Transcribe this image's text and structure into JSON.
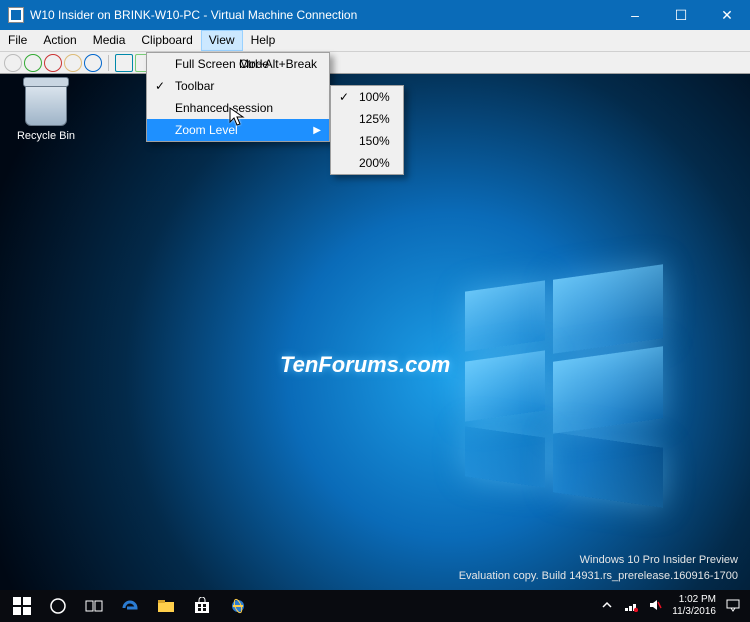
{
  "window": {
    "title": "W10 Insider on BRINK-W10-PC - Virtual Machine Connection",
    "minimize": "–",
    "maximize": "☐",
    "close": "✕"
  },
  "menubar": {
    "items": [
      "File",
      "Action",
      "Media",
      "Clipboard",
      "View",
      "Help"
    ],
    "open_index": 4
  },
  "view_menu": {
    "items": [
      {
        "label": "Full Screen Mode",
        "shortcut": "Ctrl+Alt+Break",
        "checked": false
      },
      {
        "label": "Toolbar",
        "checked": true
      },
      {
        "label": "Enhanced session",
        "checked": false
      },
      {
        "label": "Zoom Level",
        "submenu": true,
        "selected": true
      }
    ]
  },
  "zoom_menu": {
    "items": [
      {
        "label": "100%",
        "checked": true
      },
      {
        "label": "125%"
      },
      {
        "label": "150%"
      },
      {
        "label": "200%"
      }
    ]
  },
  "desktop": {
    "recycle_bin": "Recycle Bin",
    "watermark": "TenForums.com",
    "edition": "Windows 10 Pro Insider Preview",
    "build": "Evaluation copy. Build 14931.rs_prerelease.160916-1700"
  },
  "tray": {
    "time": "1:02 PM",
    "date": "11/3/2016"
  }
}
